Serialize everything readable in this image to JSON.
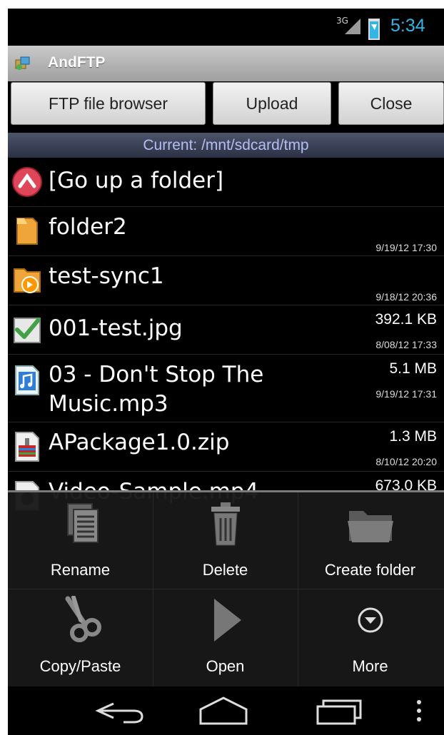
{
  "status_bar": {
    "network": "3G",
    "time": "5:34",
    "accent_color": "#33b5e5"
  },
  "title_bar": {
    "app_icon": "andftp-app-icon",
    "title": "AndFTP"
  },
  "top_buttons": {
    "browser_label": "FTP file browser",
    "upload_label": "Upload",
    "close_label": "Close"
  },
  "path": {
    "current": "Current: /mnt/sdcard/tmp"
  },
  "files": [
    {
      "icon": "go-up-arrow-icon",
      "name": "[Go up a folder]",
      "size": "",
      "date": ""
    },
    {
      "icon": "folder-icon",
      "name": "folder2",
      "size": "",
      "date": "9/19/12 17:30"
    },
    {
      "icon": "sync-folder-icon",
      "name": "test-sync1",
      "size": "",
      "date": "9/18/12 20:36"
    },
    {
      "icon": "image-file-icon",
      "name": "001-test.jpg",
      "size": "392.1 KB",
      "date": "8/08/12 17:33"
    },
    {
      "icon": "music-file-icon",
      "name": "03 - Don't Stop The\nMusic.mp3",
      "size": "5.1 MB",
      "date": "9/19/12 17:31"
    },
    {
      "icon": "archive-file-icon",
      "name": "APackage1.0.zip",
      "size": "1.3 MB",
      "date": "8/10/12 20:20"
    },
    {
      "icon": "video-file-icon",
      "name": "Video-Sample.mp4",
      "size": "673.0 KB",
      "date": ""
    }
  ],
  "context_menu": {
    "items": [
      {
        "label": "Rename",
        "icon": "rename-icon"
      },
      {
        "label": "Delete",
        "icon": "trash-icon"
      },
      {
        "label": "Create folder",
        "icon": "create-folder-icon"
      },
      {
        "label": "Copy/Paste",
        "icon": "scissors-icon"
      },
      {
        "label": "Open",
        "icon": "play-icon"
      },
      {
        "label": "More",
        "icon": "more-chevron-icon"
      }
    ]
  },
  "nav_bar": {
    "back": "back-icon",
    "home": "home-icon",
    "recents": "recents-icon",
    "overflow": "overflow-menu-icon"
  }
}
